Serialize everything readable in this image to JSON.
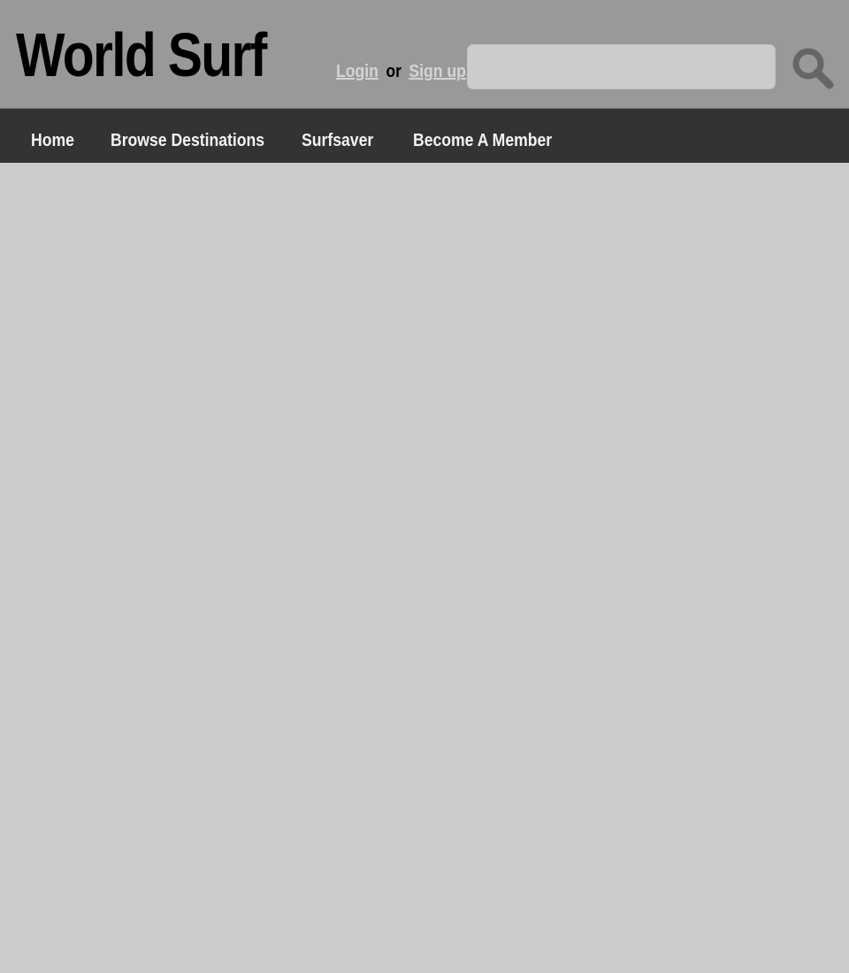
{
  "header": {
    "site_title": "World Surf",
    "login_label": "Login",
    "or_text": "or",
    "signup_label": "Sign up",
    "search": {
      "value": "",
      "placeholder": "",
      "button_icon": "search-icon"
    }
  },
  "nav": {
    "items": [
      {
        "label": "Home"
      },
      {
        "label": "Browse Destinations"
      },
      {
        "label": "Surfsaver"
      },
      {
        "label": "Become A Member"
      }
    ]
  },
  "colors": {
    "header_bg": "#999999",
    "nav_bg": "#333333",
    "page_bg": "#cccccc",
    "link": "#d4d4d4",
    "icon": "#666666"
  }
}
